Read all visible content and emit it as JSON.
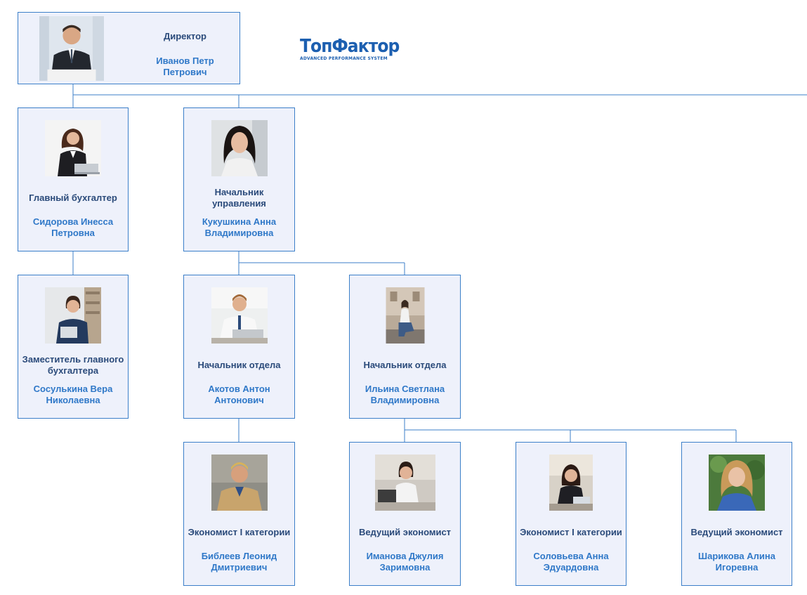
{
  "logo": {
    "word": "ТопФактор",
    "tagline": "ADVANCED PERFORMANCE SYSTEM"
  },
  "nodes": {
    "director": {
      "role": "Директор",
      "name": "Иванов Петр Петрович",
      "photo": "photo-man-suit"
    },
    "chief_accountant": {
      "role": "Главный бухгалтер",
      "name": "Сидорова Инесса Петровна",
      "photo": "photo-woman-laptop"
    },
    "deputy_chief_accountant": {
      "role": "Заместитель главного бухгалтера",
      "name": "Сосулькина Вера Николаевна",
      "photo": "photo-woman-office"
    },
    "head_of_administration": {
      "role": "Начальник управления",
      "name": "Кукушкина Анна Владимировна",
      "photo": "photo-woman-portrait"
    },
    "head_of_department_1": {
      "role": "Начальник отдела",
      "name": "Акотов Антон Антонович",
      "photo": "photo-man-laptop"
    },
    "head_of_department_2": {
      "role": "Начальник отдела",
      "name": "Ильина Светлана Владимировна",
      "photo": "photo-woman-street"
    },
    "economist_1": {
      "role": "Экономист I категории",
      "name": "Библеев Леонид Дмитриевич",
      "photo": "photo-man-worker"
    },
    "lead_economist_1": {
      "role": "Ведущий экономист",
      "name": "Иманова Джулия Заримовна",
      "photo": "photo-woman-phone"
    },
    "economist_2": {
      "role": "Экономист I категории",
      "name": "Соловьева Анна Эдуардовна",
      "photo": "photo-woman-desk"
    },
    "lead_economist_2": {
      "role": "Ведущий экономист",
      "name": "Шарикова Алина Игоревна",
      "photo": "photo-woman-smiling"
    }
  }
}
